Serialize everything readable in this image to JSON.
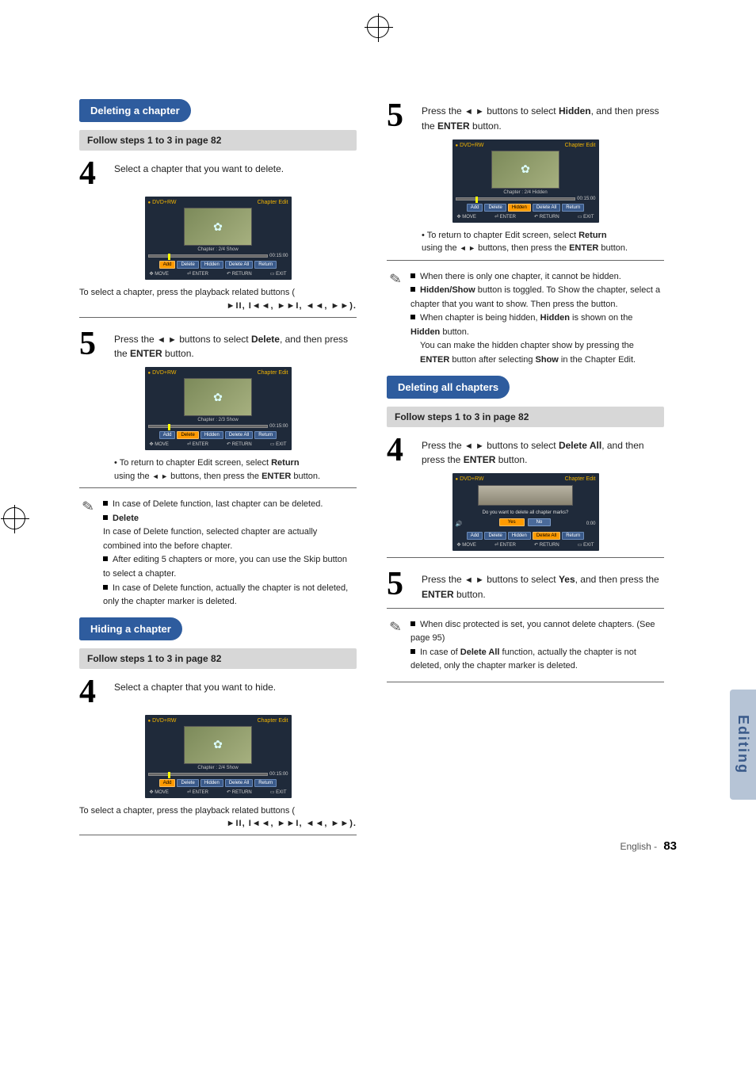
{
  "page_number": "83",
  "page_label": "English -",
  "side_tab": "Editing",
  "play_controls_glyphs": "►II, I◄◄, ►►I, ◄◄, ►►",
  "left": {
    "section1": {
      "title": "Deleting a chapter",
      "follow": "Follow steps 1 to 3 in page 82",
      "step4": {
        "num": "4",
        "text": "Select a chapter that you want to delete."
      },
      "osd4": {
        "disc": "DVD+RW",
        "header": "Chapter Edit",
        "chapter_line": "Chapter : 2/4 Show",
        "time": "00:15:00",
        "btns": [
          "Add",
          "Delete",
          "Hidden",
          "Delete All",
          "Return"
        ],
        "hl_index": 0,
        "footer": [
          "MOVE",
          "ENTER",
          "RETURN",
          "EXIT"
        ]
      },
      "play_note": "To select a chapter, press the playback related buttons (",
      "play_note_end": ").",
      "step5": {
        "num": "5",
        "pre": "Press the ",
        "arrows": "◄ ►",
        "mid": " buttons to select ",
        "target": "Delete",
        "post": ", and then press the ",
        "enter": "ENTER",
        "tail": " button."
      },
      "osd5": {
        "disc": "DVD+RW",
        "header": "Chapter Edit",
        "chapter_line": "Chapter : 2/3 Show",
        "time": "00:15:00",
        "btns": [
          "Add",
          "Delete",
          "Hidden",
          "Delete All",
          "Return"
        ],
        "hl_index": 1,
        "footer": [
          "MOVE",
          "ENTER",
          "RETURN",
          "EXIT"
        ]
      },
      "return_line_a": "• To return to chapter Edit screen, select",
      "return_word": "Return",
      "return_line_b": "using the ",
      "return_arrows": "◄ ►",
      "return_line_c": " buttons, then press the ",
      "return_enter": "ENTER",
      "return_line_d": " button.",
      "notes": [
        "In case of Delete function, last chapter can be deleted.",
        "In case of Delete function, selected chapter are actually combined into the before chapter.",
        "After editing 5 chapters or more, you can use the Skip button to select a chapter.",
        "In case of Delete function, actually the chapter is not deleted, only the chapter marker is deleted."
      ],
      "note_delete_word": "Delete"
    },
    "section2": {
      "title": "Hiding a chapter",
      "follow": "Follow steps 1 to 3 in page 82",
      "step4": {
        "num": "4",
        "text": "Select a chapter that you want to hide."
      },
      "osd4": {
        "disc": "DVD+RW",
        "header": "Chapter Edit",
        "chapter_line": "Chapter : 2/4 Show",
        "time": "00:15:00",
        "btns": [
          "Add",
          "Delete",
          "Hidden",
          "Delete All",
          "Return"
        ],
        "hl_index": 0,
        "footer": [
          "MOVE",
          "ENTER",
          "RETURN",
          "EXIT"
        ]
      },
      "play_note": "To select a chapter, press the playback related buttons (",
      "play_note_end": ")."
    }
  },
  "right": {
    "step5": {
      "num": "5",
      "pre": "Press the ",
      "arrows": "◄ ►",
      "mid": " buttons to select ",
      "target": "Hidden",
      "post": ", and then press the ",
      "enter": "ENTER",
      "tail": " button."
    },
    "osd5": {
      "disc": "DVD+RW",
      "header": "Chapter Edit",
      "chapter_line": "Chapter : 2/4 Hidden",
      "time": "00:15:00",
      "btns": [
        "Add",
        "Delete",
        "Hidden",
        "Delete All",
        "Return"
      ],
      "hl_index": 2,
      "footer": [
        "MOVE",
        "ENTER",
        "RETURN",
        "EXIT"
      ]
    },
    "return_line_a": "• To return to chapter Edit screen, select",
    "return_word": "Return",
    "return_line_b": "using the ",
    "return_arrows": "◄ ►",
    "return_line_c": " buttons, then press the ",
    "return_enter": "ENTER",
    "return_line_d": " button.",
    "notes_block1": {
      "n1_a": "When there is only one chapter, it cannot be hidden.",
      "n2_a": "Hidden/Show",
      "n2_b": " button is toggled. To Show the chapter, select a chapter that you want to show. Then press the button.",
      "n3_a": "When chapter is being hidden, ",
      "n3_b": "Hidden",
      "n3_c": " is shown on the ",
      "n3_d": "Hidden",
      "n3_e": " button.",
      "n4_a": "You can make the hidden chapter show by pressing the ",
      "n4_b": "ENTER",
      "n4_c": " button after selecting ",
      "n4_d": "Show",
      "n4_e": " in the Chapter Edit."
    },
    "section3": {
      "title": "Deleting all chapters",
      "follow": "Follow steps 1 to 3 in page 82",
      "step4": {
        "num": "4",
        "pre": "Press the ",
        "arrows": "◄ ►",
        "mid": " buttons to select ",
        "target": "Delete All",
        "post": ", and then press the ",
        "enter": "ENTER",
        "tail": " button."
      },
      "osd4": {
        "disc": "DVD+RW",
        "header": "Chapter Edit",
        "dialog": "Do you want to delete all chapter marks?",
        "yes": "Yes",
        "no": "No",
        "time": "0:00",
        "btns": [
          "Add",
          "Delete",
          "Hidden",
          "Delete All",
          "Return"
        ],
        "hl_index": 3,
        "footer": [
          "MOVE",
          "ENTER",
          "RETURN",
          "EXIT"
        ]
      },
      "step5": {
        "num": "5",
        "pre": "Press the ",
        "arrows": "◄ ►",
        "mid": " buttons to select ",
        "target": "Yes",
        "post": ", and then press the ",
        "enter": "ENTER",
        "tail": " button."
      },
      "notes": {
        "n1": "When disc protected is set, you cannot delete chapters. (See page 95)",
        "n2_a": "In case of ",
        "n2_b": "Delete All",
        "n2_c": " function, actually the chapter is not deleted, only the chapter marker is deleted."
      }
    }
  }
}
